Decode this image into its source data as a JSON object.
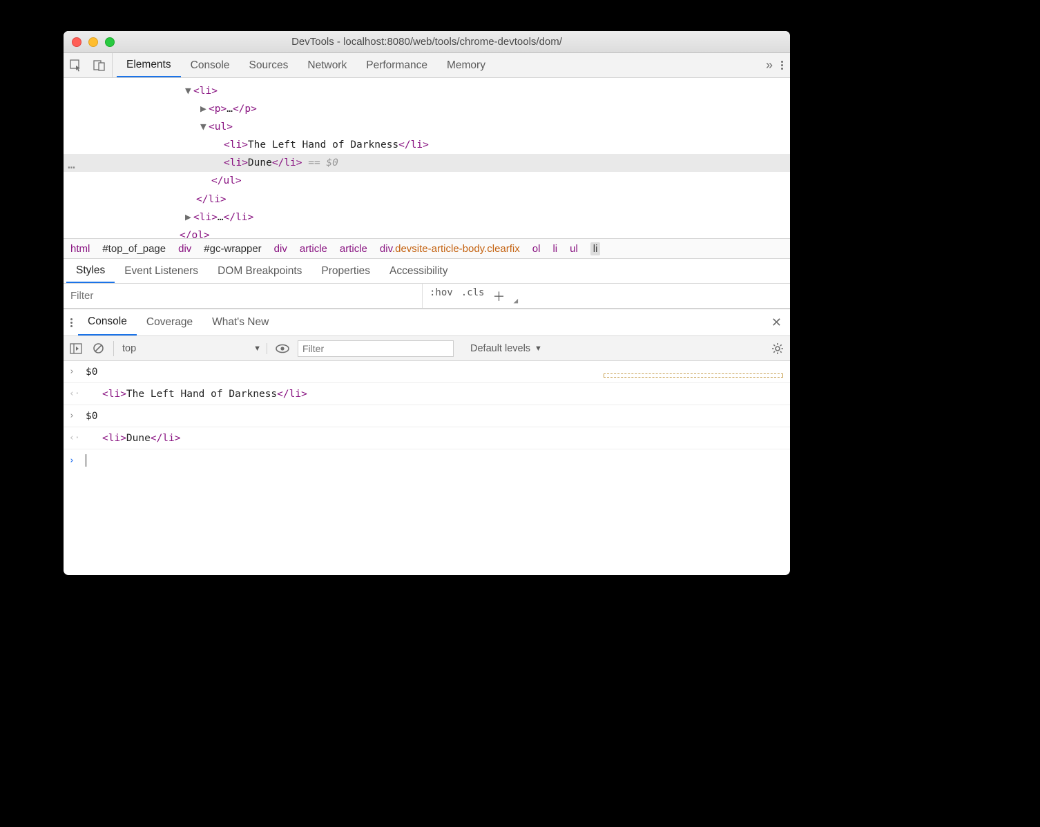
{
  "window_title": "DevTools - localhost:8080/web/tools/chrome-devtools/dom/",
  "tabs": [
    "Elements",
    "Console",
    "Sources",
    "Network",
    "Performance",
    "Memory"
  ],
  "dom": {
    "l1": "<li>",
    "l2_open": "<p>",
    "l2_ell": "…",
    "l2_close": "</p>",
    "l3": "<ul>",
    "l4_open": "<li>",
    "l4_text": "The Left Hand of Darkness",
    "l4_close": "</li>",
    "l5_open": "<li>",
    "l5_text": "Dune",
    "l5_close": "</li>",
    "l5_suffix": " == $0",
    "l6": "</ul>",
    "l7": "</li>",
    "l8_open": "<li>",
    "l8_ell": "…",
    "l8_close": "</li>",
    "l9": "</ol>"
  },
  "breadcrumb": [
    "html",
    "#top_of_page",
    "div",
    "#gc-wrapper",
    "div",
    "article",
    "article",
    "div",
    ".devsite-article-body.clearfix",
    "ol",
    "li",
    "ul",
    "li"
  ],
  "sub_tabs": [
    "Styles",
    "Event Listeners",
    "DOM Breakpoints",
    "Properties",
    "Accessibility"
  ],
  "styles_filter_placeholder": "Filter",
  "styles_buttons": {
    "hov": ":hov",
    "cls": ".cls"
  },
  "drawer_tabs": [
    "Console",
    "Coverage",
    "What's New"
  ],
  "console_toolbar": {
    "context": "top",
    "filter_placeholder": "Filter",
    "levels": "Default levels"
  },
  "console_rows": [
    {
      "arrow": ">",
      "text": "$0"
    },
    {
      "arrow": "<·",
      "tagopen": "<li>",
      "body": "The Left Hand of Darkness",
      "tagclose": "</li>"
    },
    {
      "arrow": ">",
      "text": "$0"
    },
    {
      "arrow": "<·",
      "tagopen": "<li>",
      "body": "Dune",
      "tagclose": "</li>"
    },
    {
      "arrow": ">",
      "cursor": true
    }
  ]
}
